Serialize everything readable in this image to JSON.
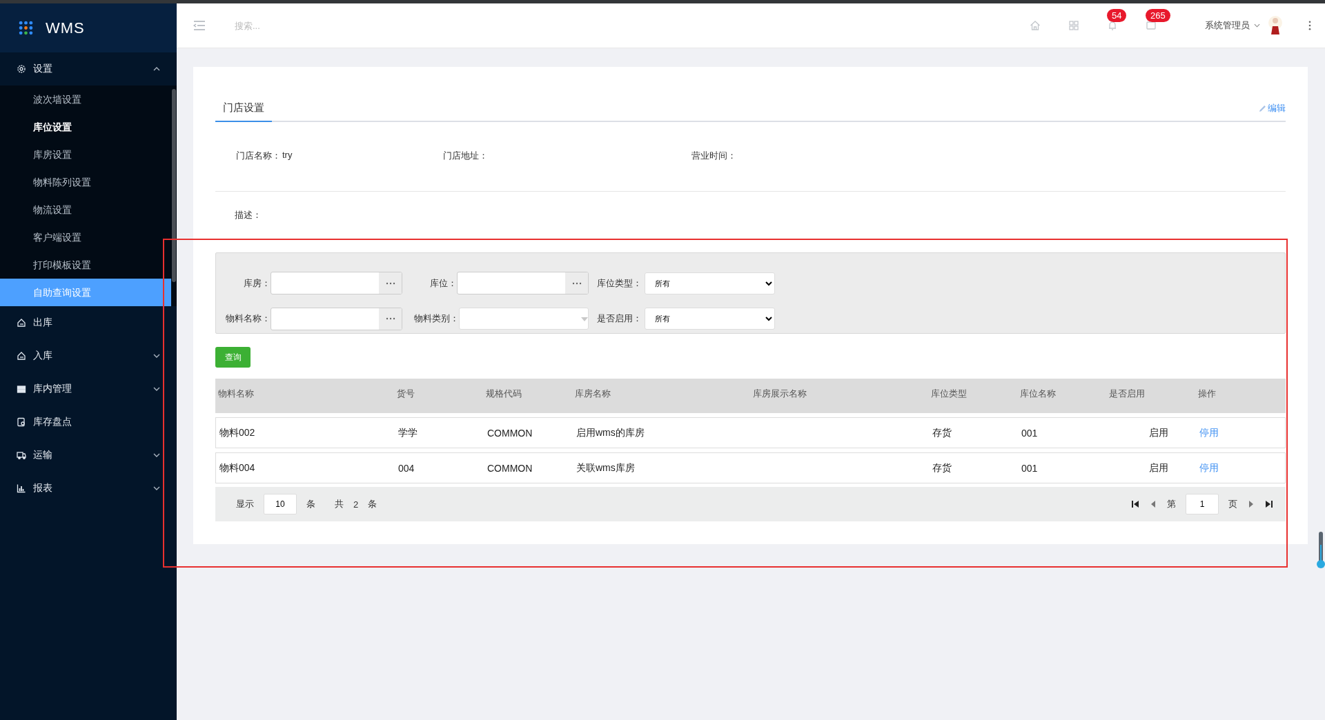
{
  "app": {
    "name": "WMS"
  },
  "sidebar": {
    "items": [
      {
        "label": "设置",
        "expanded": true,
        "has_children": true,
        "children": [
          {
            "label": "波次墙设置",
            "selected": false,
            "bold": false
          },
          {
            "label": "库位设置",
            "selected": false,
            "bold": true
          },
          {
            "label": "库房设置",
            "selected": false,
            "bold": false
          },
          {
            "label": "物料陈列设置",
            "selected": false,
            "bold": false
          },
          {
            "label": "物流设置",
            "selected": false,
            "bold": false
          },
          {
            "label": "客户端设置",
            "selected": false,
            "bold": false
          },
          {
            "label": "打印模板设置",
            "selected": false,
            "bold": false
          },
          {
            "label": "自助查询设置",
            "selected": true,
            "bold": false
          }
        ]
      },
      {
        "label": "出库",
        "expanded": false,
        "has_children": false
      },
      {
        "label": "入库",
        "expanded": false,
        "has_children": true
      },
      {
        "label": "库内管理",
        "expanded": false,
        "has_children": true
      },
      {
        "label": "库存盘点",
        "expanded": false,
        "has_children": false
      },
      {
        "label": "运输",
        "expanded": false,
        "has_children": true
      },
      {
        "label": "报表",
        "expanded": false,
        "has_children": true
      }
    ]
  },
  "topbar": {
    "search": {
      "placeholder": "搜索..."
    },
    "notifications": "54",
    "messages": "265",
    "user": "系统管理员"
  },
  "card": {
    "tab": "门店设置",
    "edit": "编辑",
    "info": [
      {
        "label": "门店名称：",
        "value": "try"
      },
      {
        "label": "门店地址："
      },
      {
        "label": "营业时间："
      }
    ],
    "description": {
      "label": "描述："
    }
  },
  "filters": [
    {
      "kind": "picker",
      "label": "库房："
    },
    {
      "kind": "picker",
      "label": "库位："
    },
    {
      "kind": "select",
      "label": "库位类型：",
      "value": "所有"
    },
    {
      "kind": "picker",
      "label": "物料名称："
    },
    {
      "kind": "combo",
      "label": "物料类别："
    },
    {
      "kind": "select",
      "label": "是否启用：",
      "value": "所有"
    }
  ],
  "query_button": "查询",
  "table": {
    "columns": [
      "物料名称",
      "货号",
      "规格代码",
      "库房名称",
      "库房展示名称",
      "库位类型",
      "库位名称",
      "是否启用",
      "操作"
    ],
    "rows": [
      {
        "cells": [
          "物料002",
          "学学",
          "COMMON",
          "启用wms的库房",
          "",
          "存货",
          "001",
          "启用"
        ],
        "action": "停用"
      },
      {
        "cells": [
          "物料004",
          "004",
          "COMMON",
          "关联wms库房",
          "",
          "存货",
          "001",
          "启用"
        ],
        "action": "停用"
      }
    ]
  },
  "pagination": {
    "show": "显示",
    "page_size": "10",
    "unit": "条",
    "total_prefix": "共",
    "total": "2",
    "total_unit": "条",
    "page_prefix": "第",
    "page": "1",
    "page_suffix": "页"
  }
}
